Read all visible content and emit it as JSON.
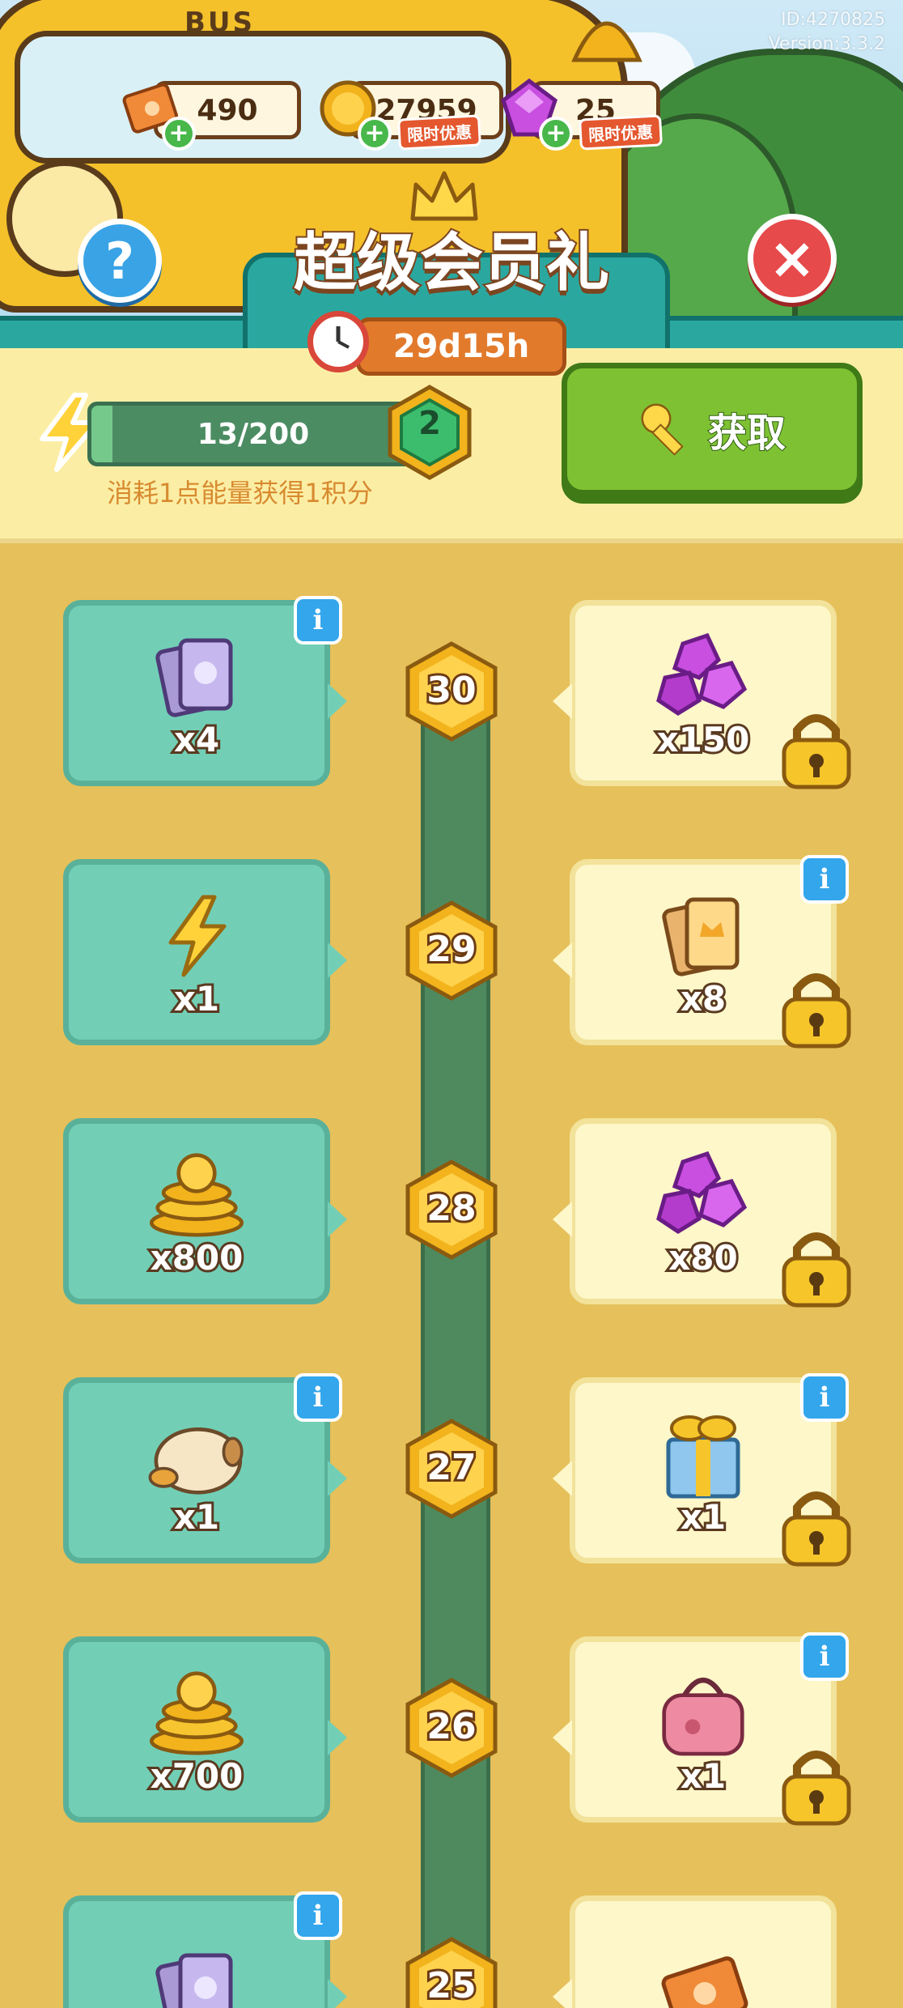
{
  "meta": {
    "id": "ID:4270825",
    "version": "Version:3.3.2"
  },
  "currencies": {
    "tickets": {
      "value": "490",
      "icon": "ticket-icon"
    },
    "coins": {
      "value": "27959",
      "promo": "限时优惠",
      "icon": "coin-icon"
    },
    "gems": {
      "value": "25",
      "promo": "限时优惠",
      "icon": "gem-icon"
    }
  },
  "title": "超级会员礼",
  "timer": "29d15h",
  "energy": {
    "progress": "13/200",
    "current": 13,
    "max": 200,
    "level": "2",
    "hint": "消耗1点能量获得1积分"
  },
  "get_button": "获取",
  "colors": {
    "free_card": "#72cfb6",
    "vip_card": "#fdf7c9",
    "accent_green": "#7ec233",
    "gold": "#f2b31c"
  },
  "levels": [
    {
      "level": "30",
      "free": {
        "item": "card-pack",
        "qty": "x4",
        "info": true
      },
      "vip": {
        "item": "gem-pile",
        "qty": "x150",
        "info": false,
        "locked": true
      }
    },
    {
      "level": "29",
      "free": {
        "item": "energy-bolt",
        "qty": "x1",
        "info": false
      },
      "vip": {
        "item": "gold-card-pack",
        "qty": "x8",
        "info": true,
        "locked": true
      }
    },
    {
      "level": "28",
      "free": {
        "item": "coin-pile",
        "qty": "x800",
        "info": false
      },
      "vip": {
        "item": "gem-pile",
        "qty": "x80",
        "info": false,
        "locked": true
      }
    },
    {
      "level": "27",
      "free": {
        "item": "pet-pug",
        "qty": "x1",
        "info": true
      },
      "vip": {
        "item": "gift-box",
        "qty": "x1",
        "info": true,
        "locked": true
      }
    },
    {
      "level": "26",
      "free": {
        "item": "coin-pile",
        "qty": "x700",
        "info": false
      },
      "vip": {
        "item": "pink-bag",
        "qty": "x1",
        "info": true,
        "locked": true
      }
    },
    {
      "level": "25",
      "free": {
        "item": "card-pack",
        "qty": "",
        "info": true
      },
      "vip": {
        "item": "ticket",
        "qty": "",
        "info": false,
        "locked": false
      }
    }
  ]
}
